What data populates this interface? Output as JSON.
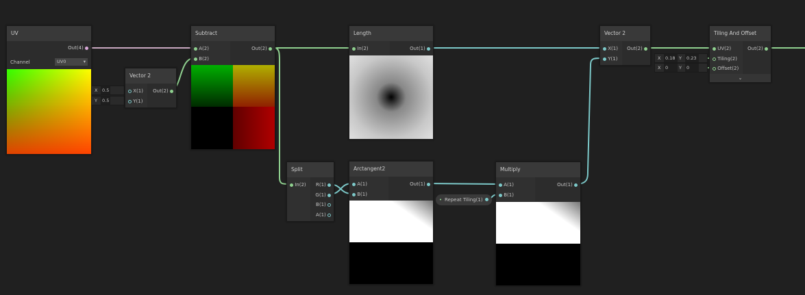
{
  "nodes": {
    "uv": {
      "title": "UV",
      "out": "Out(4)",
      "channel_label": "Channel",
      "channel_value": "UV0"
    },
    "vec2a": {
      "title": "Vector 2",
      "x": "X(1)",
      "y": "Y(1)",
      "out": "Out(2)",
      "field_x_label": "X",
      "field_x": "0.5",
      "field_y_label": "Y",
      "field_y": "0.5"
    },
    "subtract": {
      "title": "Subtract",
      "a": "A(2)",
      "b": "B(2)",
      "out": "Out(2)"
    },
    "length": {
      "title": "Length",
      "in": "In(2)",
      "out": "Out(1)"
    },
    "vec2b": {
      "title": "Vector 2",
      "x": "X(1)",
      "y": "Y(1)",
      "out": "Out(2)"
    },
    "tiling": {
      "title": "Tiling And Offset",
      "uv": "UV(2)",
      "tiling": "Tiling(2)",
      "offset": "Offset(2)",
      "out": "Out(2)",
      "tx_label": "X",
      "tx": "0.18",
      "ty_label": "Y",
      "ty": "0.23",
      "ox_label": "X",
      "ox": "0",
      "oy_label": "Y",
      "oy": "0"
    },
    "split": {
      "title": "Split",
      "in": "In(2)",
      "r": "R(1)",
      "g": "G(1)",
      "b": "B(1)",
      "a": "A(1)"
    },
    "atan2": {
      "title": "Arctangent2",
      "a": "A(1)",
      "b": "B(1)",
      "out": "Out(1)"
    },
    "multiply": {
      "title": "Multiply",
      "a": "A(1)",
      "b": "B(1)",
      "out": "Out(1)"
    },
    "property": {
      "label": "Repeat Tiling(1)"
    }
  },
  "colors": {
    "vec2": "#8fd08f",
    "vec1": "#7cc8c8",
    "vec4": "#d9a8d9",
    "bg": "#202020"
  }
}
